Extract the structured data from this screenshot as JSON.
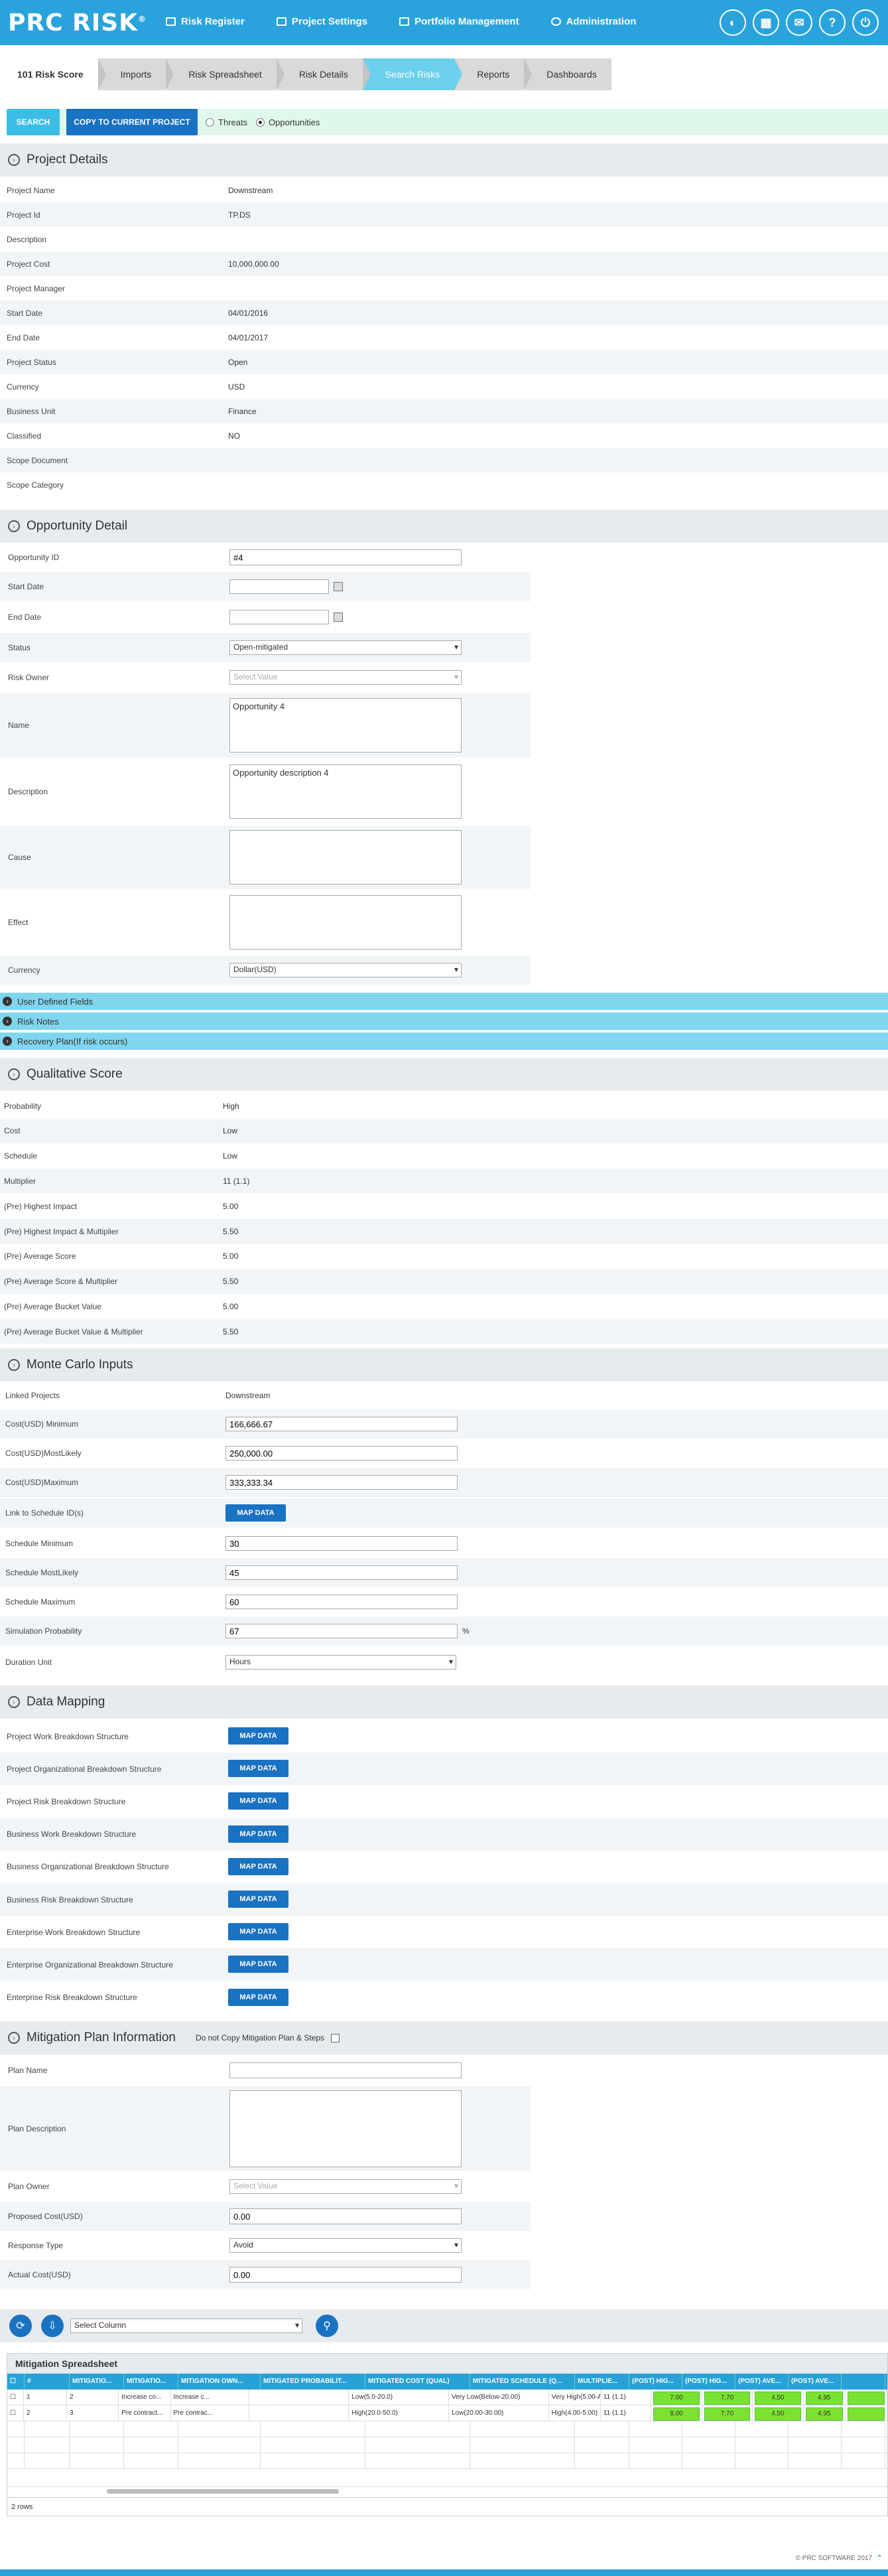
{
  "brand": {
    "logo": "PRC RISK",
    "reg": "®"
  },
  "nav": [
    "Risk Register",
    "Project Settings",
    "Portfolio Management",
    "Administration"
  ],
  "tabs": [
    "101 Risk Score",
    "Imports",
    "Risk Spreadsheet",
    "Risk Details",
    "Search Risks",
    "Reports",
    "Dashboards"
  ],
  "actions": {
    "search": "SEARCH",
    "copy": "COPY TO CURRENT PROJECT",
    "threats": "Threats",
    "opportunities": "Opportunities"
  },
  "project": {
    "title": "Project Details",
    "rows": [
      [
        "Project Name",
        "Downstream"
      ],
      [
        "Project Id",
        "TP.DS"
      ],
      [
        "Description",
        ""
      ],
      [
        "Project Cost",
        "10,000,000.00"
      ],
      [
        "Project Manager",
        ""
      ],
      [
        "Start Date",
        "04/01/2016"
      ],
      [
        "End Date",
        "04/01/2017"
      ],
      [
        "Project Status",
        "Open"
      ],
      [
        "Currency",
        "USD"
      ],
      [
        "Business Unit",
        "Finance"
      ],
      [
        "Classified",
        "NO"
      ],
      [
        "Scope Document",
        ""
      ],
      [
        "Scope Category",
        ""
      ]
    ]
  },
  "opp": {
    "title": "Opportunity Detail",
    "id_label": "Opportunity ID",
    "id": "#4",
    "start": "Start Date",
    "end": "End Date",
    "status_label": "Status",
    "status": "Open-mitigated",
    "owner_label": "Risk Owner",
    "owner_ph": "Select Value",
    "name_label": "Name",
    "name": "Opportunity 4",
    "desc_label": "Description",
    "desc": "Opportunity description 4",
    "cause": "Cause",
    "effect": "Effect",
    "currency_label": "Currency",
    "currency": "Dollar(USD)"
  },
  "collapsibles": [
    "User Defined Fields",
    "Risk Notes",
    "Recovery Plan(If risk occurs)"
  ],
  "qual": {
    "title": "Qualitative Score",
    "rows": [
      [
        "Probability",
        "High"
      ],
      [
        "Cost",
        "Low"
      ],
      [
        "Schedule",
        "Low"
      ],
      [
        "Multiplier",
        "11 (1.1)"
      ],
      [
        "(Pre) Highest Impact",
        "5.00"
      ],
      [
        "(Pre) Highest Impact & Multiplier",
        "5.50"
      ],
      [
        "(Pre) Average Score",
        "5.00"
      ],
      [
        "(Pre) Average Score & Multiplier",
        "5.50"
      ],
      [
        "(Pre) Average Bucket Value",
        "5.00"
      ],
      [
        "(Pre) Average Bucket Value & Multiplier",
        "5.50"
      ]
    ]
  },
  "mc": {
    "title": "Monte Carlo Inputs",
    "linked_label": "Linked Projects",
    "linked": "Downstream",
    "rows": [
      [
        "Cost(USD) Minimum",
        "166,666.67"
      ],
      [
        "Cost(USD)MostLikely",
        "250,000.00"
      ],
      [
        "Cost(USD)Maximum",
        "333,333.34"
      ]
    ],
    "link_label": "Link to Schedule ID(s)",
    "map": "MAP DATA",
    "sched": [
      [
        "Schedule Minimum",
        "30"
      ],
      [
        "Schedule MostLikely",
        "45"
      ],
      [
        "Schedule Maximum",
        "60"
      ],
      [
        "Simulation Probability",
        "67"
      ]
    ],
    "pct": "%",
    "dur_label": "Duration Unit",
    "dur": "Hours"
  },
  "dm": {
    "title": "Data Mapping",
    "rows": [
      "Project Work Breakdown Structure",
      "Project Organizational Breakdown Structure",
      "Project Risk Breakdown Structure",
      "Business Work Breakdown Structure",
      "Business Organizational Breakdown Structure",
      "Business Risk Breakdown Structure",
      "Enterprise Work Breakdown Structure",
      "Enterprise Organizational Breakdown Structure",
      "Enterprise Risk Breakdown Structure"
    ],
    "btn": "MAP DATA"
  },
  "mit": {
    "title": "Mitigation Plan Information",
    "nocopy": "Do not Copy Mitigation Plan & Steps",
    "plan_name": "Plan Name",
    "plan_desc": "Plan Description",
    "owner": "Plan Owner",
    "owner_ph": "Select Value",
    "proposed": "Proposed Cost(USD)",
    "proposed_v": "0.00",
    "rtype": "Response Type",
    "rtype_v": "Avoid",
    "actual": "Actual Cost(USD)",
    "actual_v": "0.00"
  },
  "grid": {
    "select_col": "Select Column",
    "title": "Mitigation Spreadsheet",
    "headers": [
      "#",
      "MITIGATIO...",
      "MITIGATIO...",
      "MITIGATION OWN...",
      "MITIGATED PROBABILIT...",
      "MITIGATED COST (QUAL)",
      "MITIGATED SCHEDULE (Q...",
      "MULTIPLIE...",
      "(POST) HIG...",
      "(POST) HIG...",
      "(POST) AVE...",
      "(POST) AVE...",
      ""
    ],
    "rows": [
      [
        "1",
        "2",
        "Increase co...",
        "Increase c...",
        "",
        "Low(5.0-20.0)",
        "Very Low(Below-20.00)",
        "Very High(5.00-Above)",
        "11 (1.1)",
        "7.00",
        "7.70",
        "4.50",
        "4.95"
      ],
      [
        "2",
        "3",
        "Pre contract...",
        "Pre contrac...",
        "",
        "High(20.0-50.0)",
        "Low(20.00-30.00)",
        "High(4.00-5.00)",
        "11 (1.1)",
        "8.00",
        "7.70",
        "4.50",
        "4.95"
      ]
    ],
    "count": "2 rows"
  },
  "footer": "© PRC SOFTWARE 2017"
}
